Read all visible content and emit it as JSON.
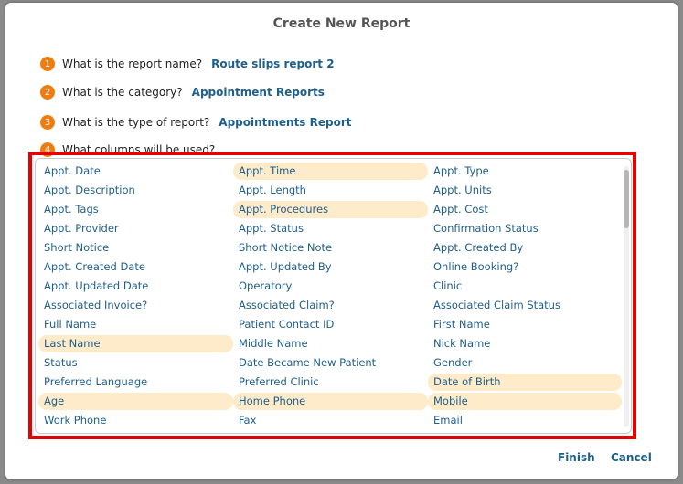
{
  "dialog": {
    "title": "Create New Report"
  },
  "questions": [
    {
      "num": "1",
      "text": "What is the report name?",
      "answer": "Route slips report 2"
    },
    {
      "num": "2",
      "text": "What is the category?",
      "answer": "Appointment Reports"
    },
    {
      "num": "3",
      "text": "What is the type of report?",
      "answer": "Appointments Report"
    },
    {
      "num": "4",
      "text": "What columns will be used?",
      "answer": ""
    }
  ],
  "columns": [
    {
      "label": "Appt. Date",
      "selected": false
    },
    {
      "label": "Appt. Time",
      "selected": true
    },
    {
      "label": "Appt. Type",
      "selected": false
    },
    {
      "label": "Appt. Description",
      "selected": false
    },
    {
      "label": "Appt. Length",
      "selected": false
    },
    {
      "label": "Appt. Units",
      "selected": false
    },
    {
      "label": "Appt. Tags",
      "selected": false
    },
    {
      "label": "Appt. Procedures",
      "selected": true
    },
    {
      "label": "Appt. Cost",
      "selected": false
    },
    {
      "label": "Appt. Provider",
      "selected": false
    },
    {
      "label": "Appt. Status",
      "selected": false
    },
    {
      "label": "Confirmation Status",
      "selected": false
    },
    {
      "label": "Short Notice",
      "selected": false
    },
    {
      "label": "Short Notice Note",
      "selected": false
    },
    {
      "label": "Appt. Created By",
      "selected": false
    },
    {
      "label": "Appt. Created Date",
      "selected": false
    },
    {
      "label": "Appt. Updated By",
      "selected": false
    },
    {
      "label": "Online Booking?",
      "selected": false
    },
    {
      "label": "Appt. Updated Date",
      "selected": false
    },
    {
      "label": "Operatory",
      "selected": false
    },
    {
      "label": "Clinic",
      "selected": false
    },
    {
      "label": "Associated Invoice?",
      "selected": false
    },
    {
      "label": "Associated Claim?",
      "selected": false
    },
    {
      "label": "Associated Claim Status",
      "selected": false
    },
    {
      "label": "Full Name",
      "selected": false
    },
    {
      "label": "Patient Contact ID",
      "selected": false
    },
    {
      "label": "First Name",
      "selected": false
    },
    {
      "label": "Last Name",
      "selected": true
    },
    {
      "label": "Middle Name",
      "selected": false
    },
    {
      "label": "Nick Name",
      "selected": false
    },
    {
      "label": "Status",
      "selected": false
    },
    {
      "label": "Date Became New Patient",
      "selected": false
    },
    {
      "label": "Gender",
      "selected": false
    },
    {
      "label": "Preferred Language",
      "selected": false
    },
    {
      "label": "Preferred Clinic",
      "selected": false
    },
    {
      "label": "Date of Birth",
      "selected": true
    },
    {
      "label": "Age",
      "selected": true
    },
    {
      "label": "Home Phone",
      "selected": true
    },
    {
      "label": "Mobile",
      "selected": true
    },
    {
      "label": "Work Phone",
      "selected": false
    },
    {
      "label": "Fax",
      "selected": false
    },
    {
      "label": "Email",
      "selected": false
    }
  ],
  "footer": {
    "finish_label": "Finish",
    "cancel_label": "Cancel"
  },
  "colors": {
    "accent": "#ee7d11",
    "link": "#1e5f8c",
    "selected_bg": "#fdebc9",
    "highlight": "#e60000"
  }
}
